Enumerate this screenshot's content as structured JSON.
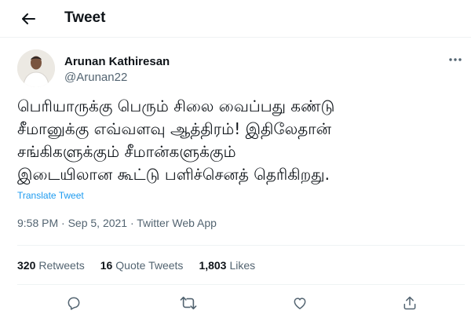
{
  "header": {
    "title": "Tweet",
    "back_icon": "arrow-left-icon"
  },
  "author": {
    "name": "Arunan Kathiresan",
    "handle": "@Arunan22"
  },
  "tweet": {
    "lines": [
      "பெரியாருக்கு பெரும் சிலை வைப்பது கண்டு",
      "சீமானுக்கு எவ்வளவு ஆத்திரம்! இதிலேதான்",
      "சங்கிகளுக்கும் சீமான்களுக்கும்",
      "இடையிலான கூட்டு பளிச்செனத் தெரிகிறது."
    ],
    "translate_label": "Translate Tweet",
    "meta": "9:58 PM · Sep 5, 2021 · Twitter Web App"
  },
  "stats": {
    "retweets_count": "320",
    "retweets_label": "Retweets",
    "quotes_count": "16",
    "quotes_label": "Quote Tweets",
    "likes_count": "1,803",
    "likes_label": "Likes"
  },
  "actions": [
    "reply-icon",
    "retweet-icon",
    "like-icon",
    "share-icon"
  ],
  "colors": {
    "text": "#0f1419",
    "secondary": "#536471",
    "link": "#1d9bf0",
    "divider": "#eff3f4"
  }
}
